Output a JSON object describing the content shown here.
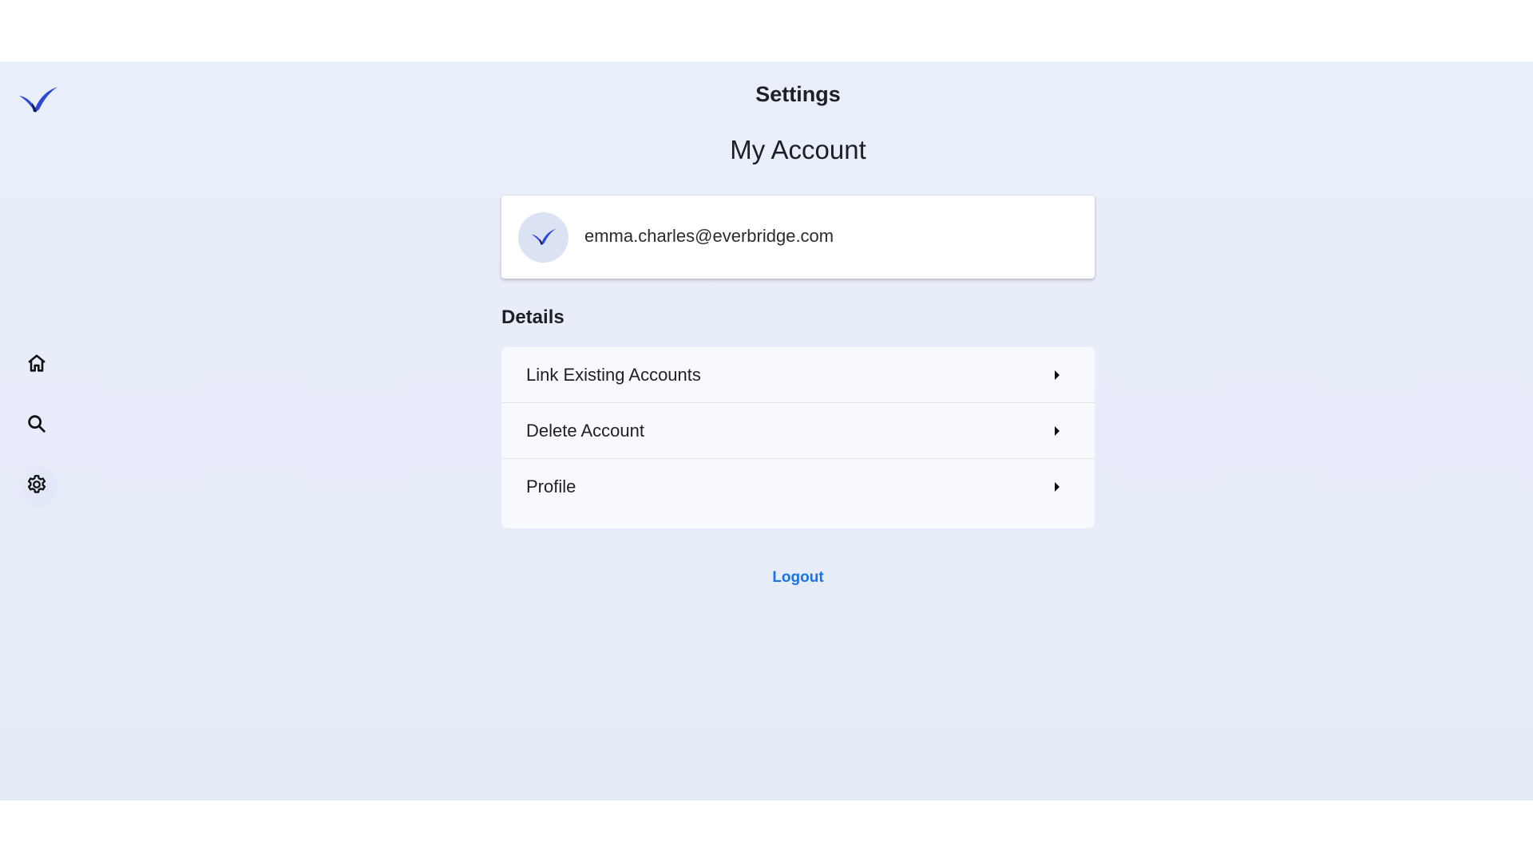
{
  "brand": {
    "logo_icon": "everbridge-swoosh-logo",
    "colors": {
      "logo_primary": "#2c48d8",
      "logo_dark": "#0f1b5a",
      "background": "#e8edfa",
      "link": "#1a73e8"
    }
  },
  "sidebar": {
    "items": [
      {
        "icon": "home-icon",
        "active": false
      },
      {
        "icon": "search-icon",
        "active": false
      },
      {
        "icon": "gear-icon",
        "active": true
      }
    ]
  },
  "header": {
    "title": "Settings"
  },
  "account": {
    "section_title": "My Account",
    "email": "emma.charles@everbridge.com",
    "avatar_icon": "everbridge-swoosh-logo"
  },
  "details": {
    "heading": "Details",
    "items": [
      {
        "label": "Link Existing Accounts",
        "icon": "caret-right-icon"
      },
      {
        "label": "Delete Account",
        "icon": "caret-right-icon"
      },
      {
        "label": "Profile",
        "icon": "caret-right-icon"
      }
    ]
  },
  "actions": {
    "logout_label": "Logout"
  }
}
